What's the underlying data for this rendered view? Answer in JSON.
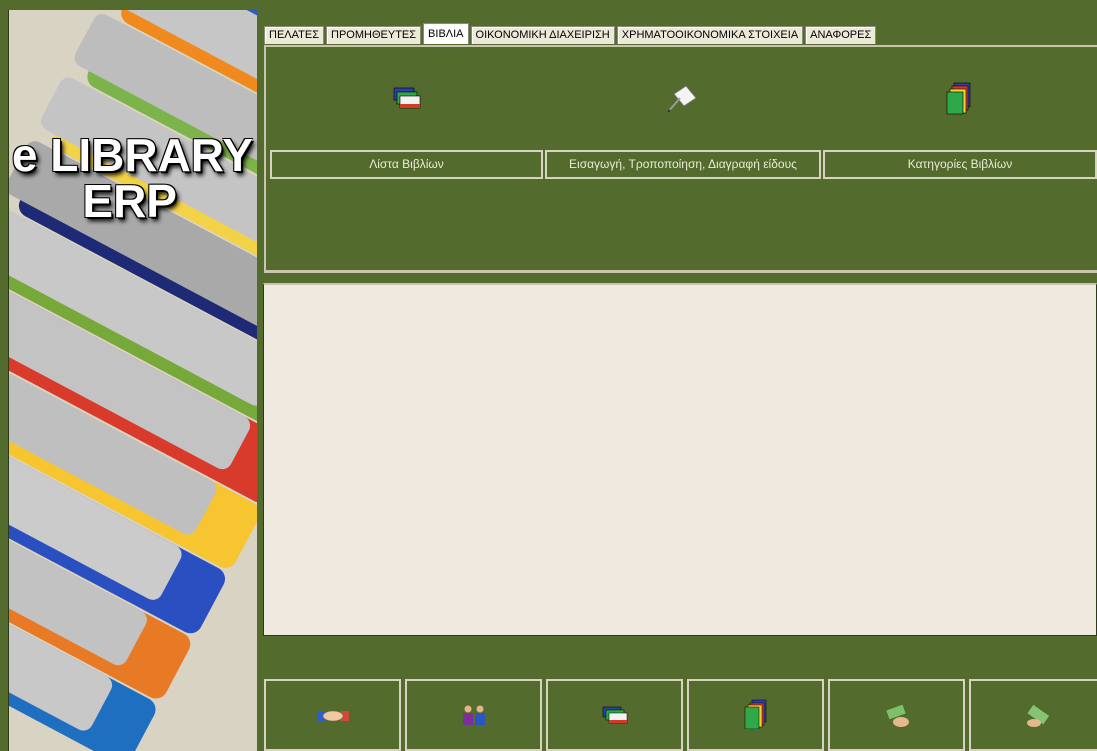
{
  "app": {
    "logo_line1": "e LIBRARY",
    "logo_line2": "ERP"
  },
  "tabs": [
    {
      "label": "ΠΕΛΑΤΕΣ",
      "active": false
    },
    {
      "label": "ΠΡΟΜΗΘΕΥΤΕΣ",
      "active": false
    },
    {
      "label": "ΒΙΒΛΙΑ",
      "active": true
    },
    {
      "label": "ΟΙΚΟΝΟΜΙΚΗ ΔΙΑΧΕΙΡΙΣΗ",
      "active": false
    },
    {
      "label": "ΧΡΗΜΑΤΟΟΙΚΟΝΟΜΙΚΑ ΣΤΟΙΧΕΙΑ",
      "active": false
    },
    {
      "label": "ΑΝΑΦΟΡΕΣ",
      "active": false
    }
  ],
  "toolbar": {
    "buttons": [
      {
        "label": "Λίστα Βιβλίων",
        "icon": "book-list-icon"
      },
      {
        "label": "Εισαγωγή, Τροποποίηση, Διαγραφή είδους",
        "icon": "edit-item-icon"
      },
      {
        "label": "Κατηγορίες Βιβλίων",
        "icon": "book-categories-icon"
      }
    ]
  },
  "bottom_toolbar": {
    "icons": [
      "handshake-icon",
      "people-icon",
      "book-list-icon",
      "folders-icon",
      "money-hand-icon",
      "money-icon"
    ]
  },
  "colors": {
    "background": "#536b2c",
    "content": "#efe9df",
    "tab": "#ece9d8",
    "button_border": "#d8d2c0"
  }
}
